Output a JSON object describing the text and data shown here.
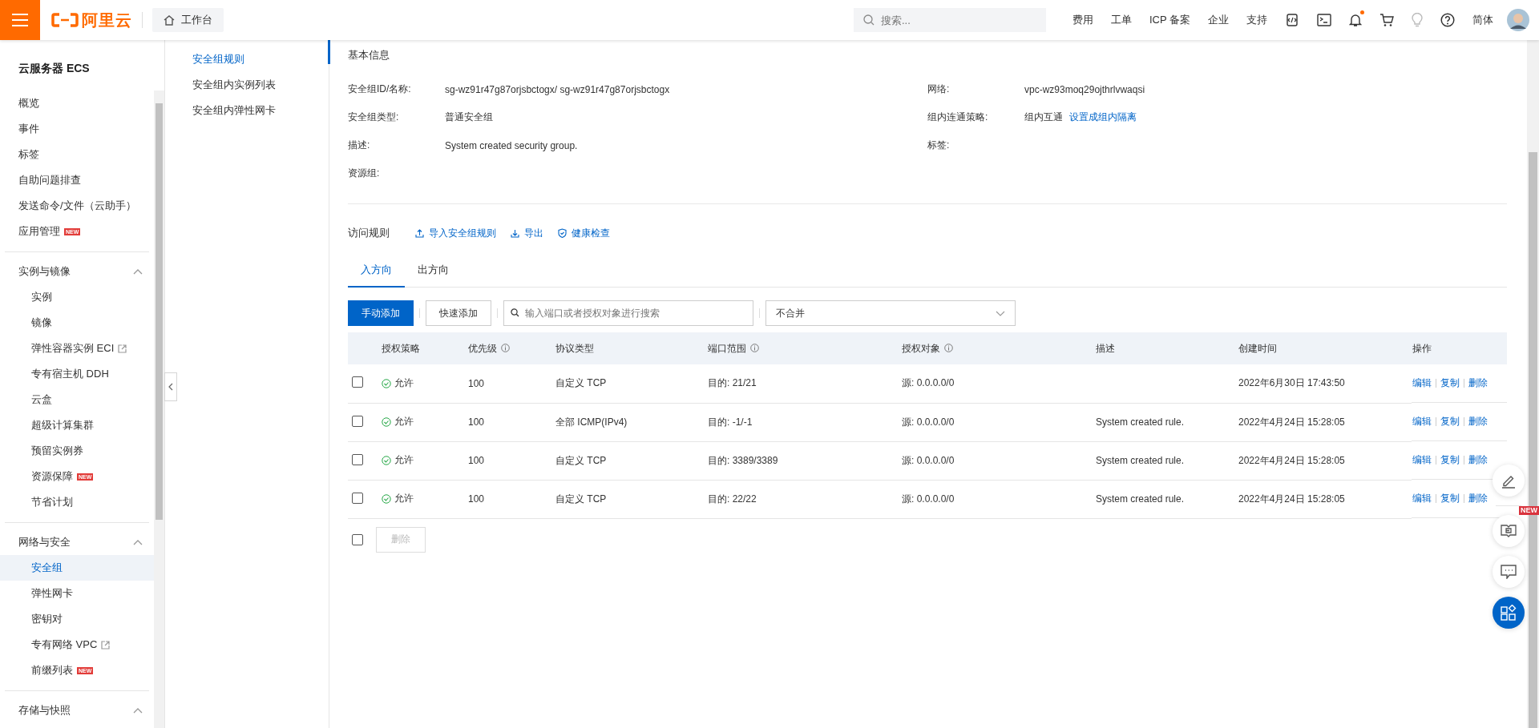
{
  "top_bar": {
    "logo": "阿里云",
    "workbench": "工作台",
    "search": {
      "placeholder": "搜索..."
    },
    "links": [
      "费用",
      "工单",
      "ICP 备案",
      "企业",
      "支持"
    ],
    "notification_dot": true,
    "language": "简体"
  },
  "sidebar": {
    "title": "云服务器 ECS",
    "items": [
      {
        "label": "概览",
        "selected": false
      },
      {
        "label": "事件",
        "selected": false
      },
      {
        "label": "标签",
        "selected": false
      },
      {
        "label": "自助问题排查",
        "selected": false
      },
      {
        "label": "发送命令/文件（云助手）",
        "selected": false
      },
      {
        "label": "应用管理",
        "badge": "NEW",
        "selected": false
      }
    ],
    "groups": [
      {
        "label": "实例与镜像",
        "expanded": true,
        "children": [
          {
            "label": "实例",
            "external": false,
            "selected": false
          },
          {
            "label": "镜像",
            "external": false,
            "selected": false
          },
          {
            "label": "弹性容器实例 ECI",
            "external": true,
            "selected": false
          },
          {
            "label": "专有宿主机 DDH",
            "external": false,
            "selected": false
          },
          {
            "label": "云盒",
            "external": false,
            "selected": false
          },
          {
            "label": "超级计算集群",
            "external": false,
            "selected": false
          },
          {
            "label": "预留实例券",
            "external": false,
            "selected": false
          },
          {
            "label": "资源保障",
            "badge": "NEW",
            "external": false,
            "selected": false
          },
          {
            "label": "节省计划",
            "external": false,
            "selected": false
          }
        ]
      },
      {
        "label": "网络与安全",
        "expanded": true,
        "children": [
          {
            "label": "安全组",
            "external": false,
            "selected": true
          },
          {
            "label": "弹性网卡",
            "external": false,
            "selected": false
          },
          {
            "label": "密钥对",
            "external": false,
            "selected": false
          },
          {
            "label": "专有网络 VPC",
            "external": true,
            "selected": false
          },
          {
            "label": "前缀列表",
            "badge": "NEW",
            "external": false,
            "selected": false
          }
        ]
      },
      {
        "label": "存储与快照",
        "expanded": true
      }
    ]
  },
  "sub_nav": [
    {
      "label": "安全组规则",
      "selected": true
    },
    {
      "label": "安全组内实例列表",
      "selected": false
    },
    {
      "label": "安全组内弹性网卡",
      "selected": false
    }
  ],
  "basic_info": {
    "title": "基本信息",
    "left": [
      {
        "label": "安全组ID/名称:",
        "value": "sg-wz91r47g87orjsbctogx/ sg-wz91r47g87orjsbctogx"
      },
      {
        "label": "安全组类型:",
        "value": "普通安全组"
      },
      {
        "label": "描述:",
        "value": "System created security group."
      },
      {
        "label": "资源组:"
      }
    ],
    "right": [
      {
        "label": "网络:",
        "value": "vpc-wz93moq29ojthrlvwaqsi"
      },
      {
        "label": "组内连通策略:",
        "value": "组内互通",
        "link": "设置成组内隔离"
      },
      {
        "label": "标签:"
      }
    ]
  },
  "rules": {
    "title": "访问规则",
    "actions": [
      {
        "kind": "upload",
        "label": "导入安全组规则"
      },
      {
        "kind": "download",
        "label": "导出"
      },
      {
        "kind": "shield",
        "label": "健康检查"
      }
    ],
    "tabs": [
      {
        "label": "入方向",
        "selected": true
      },
      {
        "label": "出方向",
        "selected": false
      }
    ],
    "add_button": "手动添加",
    "quick_add_button": "快速添加",
    "search": {
      "placeholder": "输入端口或者授权对象进行搜索"
    },
    "merge_select": "不合并",
    "columns": [
      {
        "label": "授权策略",
        "info": false
      },
      {
        "label": "优先级",
        "info": true
      },
      {
        "label": "协议类型",
        "info": false
      },
      {
        "label": "端口范围",
        "info": true
      },
      {
        "label": "授权对象",
        "info": true
      },
      {
        "label": "描述",
        "info": false
      },
      {
        "label": "创建时间",
        "info": false
      },
      {
        "label": "操作",
        "info": false
      }
    ],
    "rows": [
      {
        "checked": false,
        "policy": "允许",
        "priority": "100",
        "protocol": "自定义 TCP",
        "port": "目的: 21/21",
        "source": "源: 0.0.0.0/0",
        "created": "2022年6月30日 17:43:50",
        "ops": [
          "编辑",
          "复制",
          "删除"
        ]
      },
      {
        "checked": false,
        "policy": "允许",
        "priority": "100",
        "protocol": "全部 ICMP(IPv4)",
        "port": "目的: -1/-1",
        "source": "源: 0.0.0.0/0",
        "description": "System created rule.",
        "created": "2022年4月24日 15:28:05",
        "ops": [
          "编辑",
          "复制",
          "删除"
        ]
      },
      {
        "checked": false,
        "policy": "允许",
        "priority": "100",
        "protocol": "自定义 TCP",
        "port": "目的: 3389/3389",
        "source": "源: 0.0.0.0/0",
        "description": "System created rule.",
        "created": "2022年4月24日 15:28:05",
        "ops": [
          "编辑",
          "复制",
          "删除"
        ]
      },
      {
        "checked": false,
        "policy": "允许",
        "priority": "100",
        "protocol": "自定义 TCP",
        "port": "目的: 22/22",
        "source": "源: 0.0.0.0/0",
        "description": "System created rule.",
        "created": "2022年4月24日 15:28:05",
        "ops": [
          "编辑",
          "复制",
          "删除"
        ]
      }
    ],
    "select_all_checked": false,
    "delete_button": {
      "label": "删除",
      "disabled": true
    }
  },
  "floating": {
    "new_badge": "NEW"
  }
}
